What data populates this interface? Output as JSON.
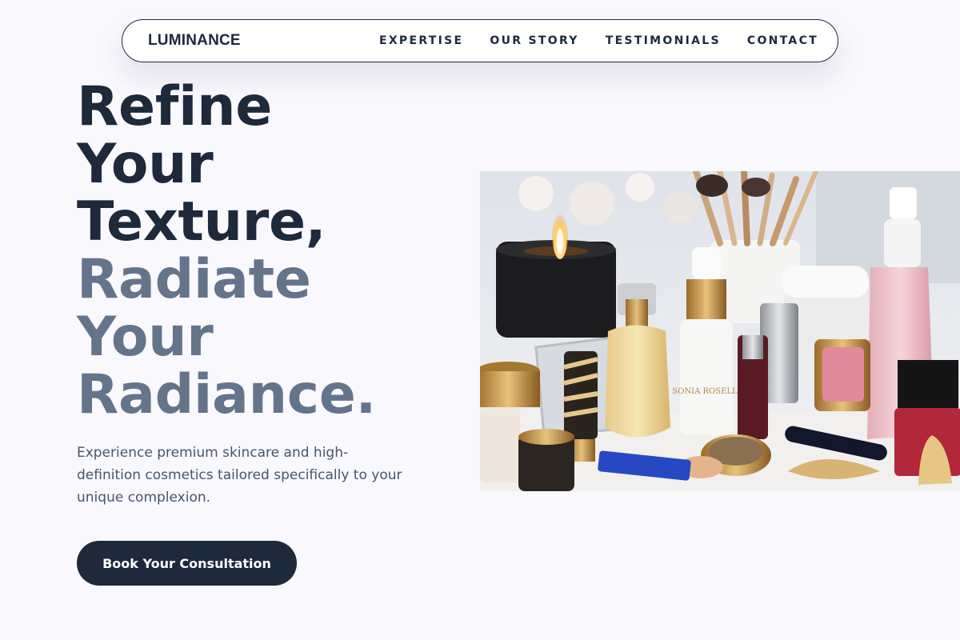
{
  "nav": {
    "logo": "LUMINANCE",
    "links": [
      "EXPERTISE",
      "OUR STORY",
      "TESTIMONIALS",
      "CONTACT"
    ]
  },
  "hero": {
    "title_dark": [
      "Refine",
      "Your",
      "Texture,"
    ],
    "title_muted": [
      "Radiate",
      "Your",
      "Radiance."
    ],
    "subtitle": "Experience premium skincare and high-definition cosmetics tailored specifically to your unique complexion.",
    "cta_label": "Book Your Consultation",
    "image_alt": "Luxury cosmetics and skincare products arranged on a vanity with a candle and makeup brushes",
    "image_product_labels": [
      "SONIA ROSELLI",
      "SONIA ROSELLI"
    ]
  },
  "colors": {
    "primary": "#1e293b",
    "muted_heading": "#64748b",
    "body_text": "#475569",
    "background": "#f8f8fd"
  }
}
